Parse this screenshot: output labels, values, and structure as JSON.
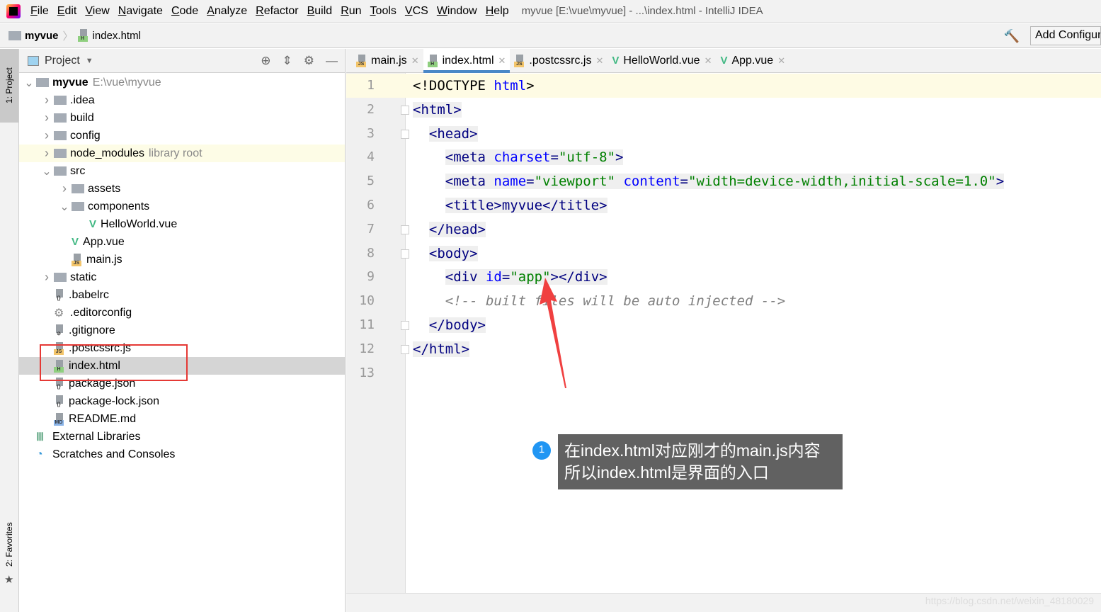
{
  "menubar": {
    "items": [
      "File",
      "Edit",
      "View",
      "Navigate",
      "Code",
      "Analyze",
      "Refactor",
      "Build",
      "Run",
      "Tools",
      "VCS",
      "Window",
      "Help"
    ],
    "window_title": "myvue [E:\\vue\\myvue] - ...\\index.html - IntelliJ IDEA"
  },
  "navbar": {
    "project": "myvue",
    "file": "index.html",
    "add_config": "Add Configuration..."
  },
  "side_tabs": {
    "project": "1: Project",
    "favorites": "2: Favorites"
  },
  "project_panel": {
    "title": "Project",
    "tree": [
      {
        "label": "myvue",
        "hint": "E:\\vue\\myvue",
        "type": "folder",
        "level": 0,
        "expanded": true
      },
      {
        "label": ".idea",
        "type": "folder",
        "level": 1,
        "expanded": false
      },
      {
        "label": "build",
        "type": "folder",
        "level": 1,
        "expanded": false
      },
      {
        "label": "config",
        "type": "folder",
        "level": 1,
        "expanded": false
      },
      {
        "label": "node_modules",
        "hint": "library root",
        "type": "folder",
        "level": 1,
        "expanded": false
      },
      {
        "label": "src",
        "type": "folder",
        "level": 1,
        "expanded": true
      },
      {
        "label": "assets",
        "type": "folder",
        "level": 2,
        "expanded": false
      },
      {
        "label": "components",
        "type": "folder",
        "level": 2,
        "expanded": true
      },
      {
        "label": "HelloWorld.vue",
        "type": "vue",
        "level": 3
      },
      {
        "label": "App.vue",
        "type": "vue",
        "level": 2
      },
      {
        "label": "main.js",
        "type": "js",
        "level": 2
      },
      {
        "label": "static",
        "type": "folder",
        "level": 1,
        "expanded": false
      },
      {
        "label": ".babelrc",
        "type": "json",
        "level": 1
      },
      {
        "label": ".editorconfig",
        "type": "gear",
        "level": 1
      },
      {
        "label": ".gitignore",
        "type": "git",
        "level": 1
      },
      {
        "label": ".postcssrc.js",
        "type": "js",
        "level": 1
      },
      {
        "label": "index.html",
        "type": "html",
        "level": 1,
        "selected": true
      },
      {
        "label": "package.json",
        "type": "json",
        "level": 1
      },
      {
        "label": "package-lock.json",
        "type": "json",
        "level": 1
      },
      {
        "label": "README.md",
        "type": "md",
        "level": 1
      },
      {
        "label": "External Libraries",
        "type": "lib",
        "level": 0
      },
      {
        "label": "Scratches and Consoles",
        "type": "scratch",
        "level": 0
      }
    ]
  },
  "tabs": [
    {
      "label": "main.js",
      "type": "js"
    },
    {
      "label": "index.html",
      "type": "html",
      "active": true
    },
    {
      "label": ".postcssrc.js",
      "type": "js"
    },
    {
      "label": "HelloWorld.vue",
      "type": "vue"
    },
    {
      "label": "App.vue",
      "type": "vue"
    }
  ],
  "code_lines": [
    "<!DOCTYPE html>",
    "<html>",
    "  <head>",
    "    <meta charset=\"utf-8\">",
    "    <meta name=\"viewport\" content=\"width=device-width,initial-scale=1.0\">",
    "    <title>myvue</title>",
    "  </head>",
    "  <body>",
    "    <div id=\"app\"></div>",
    "    <!-- built files will be auto injected -->",
    "  </body>",
    "</html>",
    ""
  ],
  "annotation": {
    "number": "1",
    "line1": "在index.html对应刚才的main.js内容",
    "line2": "所以index.html是界面的入口"
  },
  "watermark": "https://blog.csdn.net/weixin_48180029",
  "colors": {
    "tag": "#000080",
    "attr": "#0000ff",
    "value": "#008000",
    "comment": "#808080",
    "highlight_box": "#e53935",
    "callout_bg": "#616161",
    "accent": "#4a88c7"
  }
}
